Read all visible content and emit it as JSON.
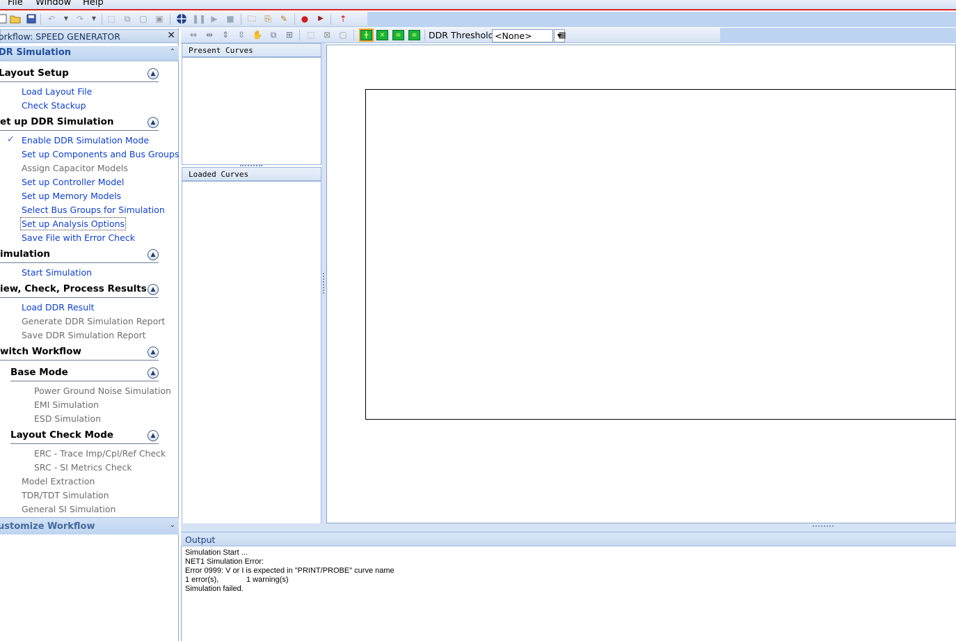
{
  "menu": {
    "file": "File",
    "window": "Window",
    "help": "Help"
  },
  "workflow": {
    "title": "orkflow: SPEED GENERATOR",
    "close": "✕",
    "ddr_header": "DR Simulation",
    "sections": {
      "layout_setup": {
        "title": "Layout Setup",
        "items": [
          "Load Layout File",
          "Check Stackup"
        ]
      },
      "setup_ddr": {
        "title": "et up DDR Simulation",
        "items": [
          "Enable DDR Simulation Mode",
          "Set up Components and Bus Groups",
          "Assign Capacitor Models",
          "Set up Controller Model",
          "Set up Memory Models",
          "Select Bus Groups for Simulation",
          "Set up Analysis Options",
          "Save File with Error Check"
        ]
      },
      "simulation": {
        "title": "imulation",
        "items": [
          "Start Simulation"
        ]
      },
      "view_results": {
        "title": "iew, Check, Process Results",
        "items": [
          "Load DDR Result",
          "Generate DDR Simulation Report",
          "Save DDR Simulation Report"
        ]
      },
      "switch_workflow": {
        "title": "witch Workflow"
      },
      "base_mode": {
        "title": "Base Mode",
        "items": [
          "Power Ground Noise Simulation",
          "EMI Simulation",
          "ESD Simulation"
        ]
      },
      "layout_check": {
        "title": "Layout Check Mode",
        "items": [
          "ERC - Trace Imp/Cpl/Ref Check",
          "SRC - SI Metrics Check"
        ]
      },
      "other_items": [
        "Model Extraction",
        "TDR/TDT Simulation",
        "General SI Simulation"
      ]
    },
    "customize_header": "ustomize Workflow"
  },
  "toolbar2": {
    "ddr_threshold_label": "DDR Threshold:",
    "ddr_threshold_value": "<None>"
  },
  "panes": {
    "present_curves": "Present Curves",
    "loaded_curves": "Loaded Curves"
  },
  "output": {
    "title": "Output",
    "lines": [
      "Simulation Start ...",
      "NET1 Simulation Error:",
      "Error 0999: V or I is expected in \"PRINT/PROBE\" curve name",
      "1 error(s),             1 warning(s)",
      "Simulation failed."
    ]
  },
  "icons": {
    "collapse": "⌃",
    "expand": "⌄",
    "section_collapse": "▲",
    "check": "✓"
  },
  "colors": {
    "link": "#0b3fd1",
    "disabled": "#6d6d6d",
    "accent_red": "#d81f1f"
  }
}
